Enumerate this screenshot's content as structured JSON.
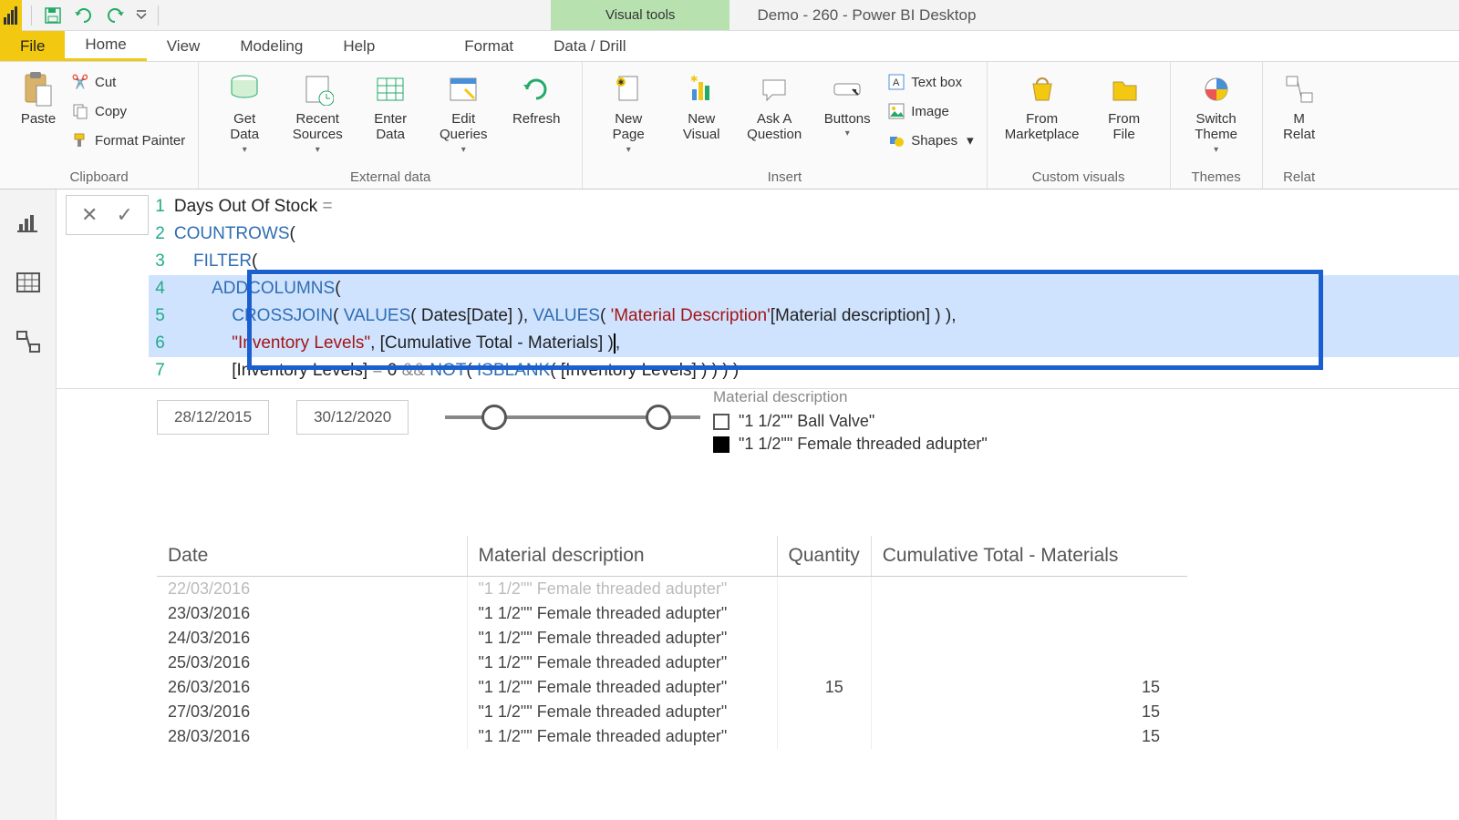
{
  "app": {
    "title": "Demo - 260 - Power BI Desktop",
    "contextual_tab_group": "Visual tools"
  },
  "qat": {
    "save": "Save",
    "undo": "Undo",
    "redo": "Redo"
  },
  "tabs": {
    "file": "File",
    "home": "Home",
    "view": "View",
    "modeling": "Modeling",
    "help": "Help",
    "format": "Format",
    "datadrill": "Data / Drill"
  },
  "ribbon": {
    "clipboard": {
      "group": "Clipboard",
      "paste": "Paste",
      "cut": "Cut",
      "copy": "Copy",
      "format_painter": "Format Painter"
    },
    "external": {
      "group": "External data",
      "get_data": "Get\nData",
      "recent_sources": "Recent\nSources",
      "enter_data": "Enter\nData",
      "edit_queries": "Edit\nQueries",
      "refresh": "Refresh"
    },
    "insert": {
      "group": "Insert",
      "new_page": "New\nPage",
      "new_visual": "New\nVisual",
      "ask_q": "Ask A\nQuestion",
      "buttons": "Buttons",
      "text_box": "Text box",
      "image": "Image",
      "shapes": "Shapes"
    },
    "custom_visuals": {
      "group": "Custom visuals",
      "from_marketplace": "From\nMarketplace",
      "from_file": "From\nFile"
    },
    "themes": {
      "group": "Themes",
      "switch_theme": "Switch\nTheme"
    },
    "relationships": {
      "group": "Relat",
      "manage": "M\nRelat"
    }
  },
  "formula": {
    "lines": [
      "Days Out Of Stock =",
      "COUNTROWS(",
      "    FILTER(",
      "        ADDCOLUMNS(",
      "            CROSSJOIN( VALUES( Dates[Date] ), VALUES( 'Material Description'[Material description] ) ),",
      "            \"Inventory Levels\", [Cumulative Total - Materials] ),",
      "            [Inventory Levels] = 0 && NOT( ISBLANK( [Inventory Levels] ) ) ) )"
    ]
  },
  "slicer": {
    "start": "28/12/2015",
    "end": "30/12/2020"
  },
  "legend": {
    "header": "Material description",
    "items": [
      {
        "label": "\"1 1/2\"\" Ball Valve\"",
        "checked": false
      },
      {
        "label": "\"1 1/2\"\" Female threaded adupter\"",
        "checked": true
      }
    ]
  },
  "table": {
    "headers": [
      "Date",
      "Material description",
      "Quantity",
      "Cumulative Total - Materials"
    ],
    "rows": [
      {
        "date": "22/03/2016",
        "desc": "\"1 1/2\"\" Female threaded adupter\"",
        "qty": "",
        "cum": "",
        "cut": true
      },
      {
        "date": "23/03/2016",
        "desc": "\"1 1/2\"\" Female threaded adupter\"",
        "qty": "",
        "cum": ""
      },
      {
        "date": "24/03/2016",
        "desc": "\"1 1/2\"\" Female threaded adupter\"",
        "qty": "",
        "cum": ""
      },
      {
        "date": "25/03/2016",
        "desc": "\"1 1/2\"\" Female threaded adupter\"",
        "qty": "",
        "cum": ""
      },
      {
        "date": "26/03/2016",
        "desc": "\"1 1/2\"\" Female threaded adupter\"",
        "qty": "15",
        "cum": "15"
      },
      {
        "date": "27/03/2016",
        "desc": "\"1 1/2\"\" Female threaded adupter\"",
        "qty": "",
        "cum": "15"
      },
      {
        "date": "28/03/2016",
        "desc": "\"1 1/2\"\" Female threaded adupter\"",
        "qty": "",
        "cum": "15"
      }
    ]
  }
}
